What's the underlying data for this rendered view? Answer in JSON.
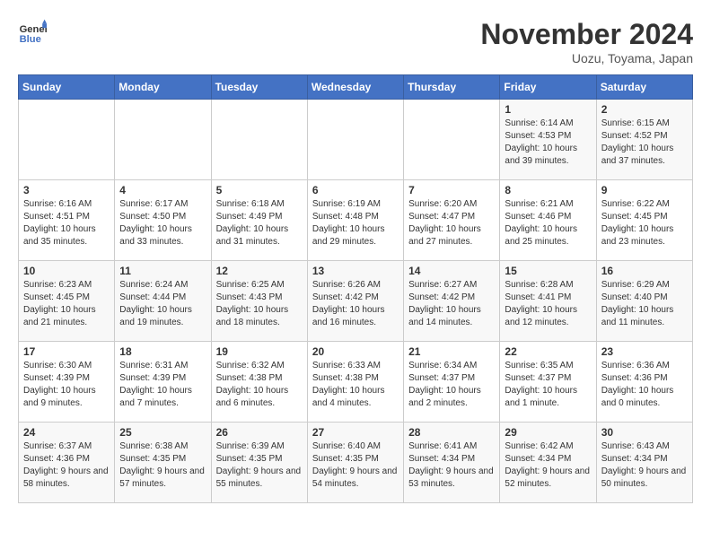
{
  "header": {
    "logo_general": "General",
    "logo_blue": "Blue",
    "month_title": "November 2024",
    "location": "Uozu, Toyama, Japan"
  },
  "days_of_week": [
    "Sunday",
    "Monday",
    "Tuesday",
    "Wednesday",
    "Thursday",
    "Friday",
    "Saturday"
  ],
  "weeks": [
    [
      {
        "day": "",
        "content": ""
      },
      {
        "day": "",
        "content": ""
      },
      {
        "day": "",
        "content": ""
      },
      {
        "day": "",
        "content": ""
      },
      {
        "day": "",
        "content": ""
      },
      {
        "day": "1",
        "content": "Sunrise: 6:14 AM\nSunset: 4:53 PM\nDaylight: 10 hours and 39 minutes."
      },
      {
        "day": "2",
        "content": "Sunrise: 6:15 AM\nSunset: 4:52 PM\nDaylight: 10 hours and 37 minutes."
      }
    ],
    [
      {
        "day": "3",
        "content": "Sunrise: 6:16 AM\nSunset: 4:51 PM\nDaylight: 10 hours and 35 minutes."
      },
      {
        "day": "4",
        "content": "Sunrise: 6:17 AM\nSunset: 4:50 PM\nDaylight: 10 hours and 33 minutes."
      },
      {
        "day": "5",
        "content": "Sunrise: 6:18 AM\nSunset: 4:49 PM\nDaylight: 10 hours and 31 minutes."
      },
      {
        "day": "6",
        "content": "Sunrise: 6:19 AM\nSunset: 4:48 PM\nDaylight: 10 hours and 29 minutes."
      },
      {
        "day": "7",
        "content": "Sunrise: 6:20 AM\nSunset: 4:47 PM\nDaylight: 10 hours and 27 minutes."
      },
      {
        "day": "8",
        "content": "Sunrise: 6:21 AM\nSunset: 4:46 PM\nDaylight: 10 hours and 25 minutes."
      },
      {
        "day": "9",
        "content": "Sunrise: 6:22 AM\nSunset: 4:45 PM\nDaylight: 10 hours and 23 minutes."
      }
    ],
    [
      {
        "day": "10",
        "content": "Sunrise: 6:23 AM\nSunset: 4:45 PM\nDaylight: 10 hours and 21 minutes."
      },
      {
        "day": "11",
        "content": "Sunrise: 6:24 AM\nSunset: 4:44 PM\nDaylight: 10 hours and 19 minutes."
      },
      {
        "day": "12",
        "content": "Sunrise: 6:25 AM\nSunset: 4:43 PM\nDaylight: 10 hours and 18 minutes."
      },
      {
        "day": "13",
        "content": "Sunrise: 6:26 AM\nSunset: 4:42 PM\nDaylight: 10 hours and 16 minutes."
      },
      {
        "day": "14",
        "content": "Sunrise: 6:27 AM\nSunset: 4:42 PM\nDaylight: 10 hours and 14 minutes."
      },
      {
        "day": "15",
        "content": "Sunrise: 6:28 AM\nSunset: 4:41 PM\nDaylight: 10 hours and 12 minutes."
      },
      {
        "day": "16",
        "content": "Sunrise: 6:29 AM\nSunset: 4:40 PM\nDaylight: 10 hours and 11 minutes."
      }
    ],
    [
      {
        "day": "17",
        "content": "Sunrise: 6:30 AM\nSunset: 4:39 PM\nDaylight: 10 hours and 9 minutes."
      },
      {
        "day": "18",
        "content": "Sunrise: 6:31 AM\nSunset: 4:39 PM\nDaylight: 10 hours and 7 minutes."
      },
      {
        "day": "19",
        "content": "Sunrise: 6:32 AM\nSunset: 4:38 PM\nDaylight: 10 hours and 6 minutes."
      },
      {
        "day": "20",
        "content": "Sunrise: 6:33 AM\nSunset: 4:38 PM\nDaylight: 10 hours and 4 minutes."
      },
      {
        "day": "21",
        "content": "Sunrise: 6:34 AM\nSunset: 4:37 PM\nDaylight: 10 hours and 2 minutes."
      },
      {
        "day": "22",
        "content": "Sunrise: 6:35 AM\nSunset: 4:37 PM\nDaylight: 10 hours and 1 minute."
      },
      {
        "day": "23",
        "content": "Sunrise: 6:36 AM\nSunset: 4:36 PM\nDaylight: 10 hours and 0 minutes."
      }
    ],
    [
      {
        "day": "24",
        "content": "Sunrise: 6:37 AM\nSunset: 4:36 PM\nDaylight: 9 hours and 58 minutes."
      },
      {
        "day": "25",
        "content": "Sunrise: 6:38 AM\nSunset: 4:35 PM\nDaylight: 9 hours and 57 minutes."
      },
      {
        "day": "26",
        "content": "Sunrise: 6:39 AM\nSunset: 4:35 PM\nDaylight: 9 hours and 55 minutes."
      },
      {
        "day": "27",
        "content": "Sunrise: 6:40 AM\nSunset: 4:35 PM\nDaylight: 9 hours and 54 minutes."
      },
      {
        "day": "28",
        "content": "Sunrise: 6:41 AM\nSunset: 4:34 PM\nDaylight: 9 hours and 53 minutes."
      },
      {
        "day": "29",
        "content": "Sunrise: 6:42 AM\nSunset: 4:34 PM\nDaylight: 9 hours and 52 minutes."
      },
      {
        "day": "30",
        "content": "Sunrise: 6:43 AM\nSunset: 4:34 PM\nDaylight: 9 hours and 50 minutes."
      }
    ]
  ]
}
